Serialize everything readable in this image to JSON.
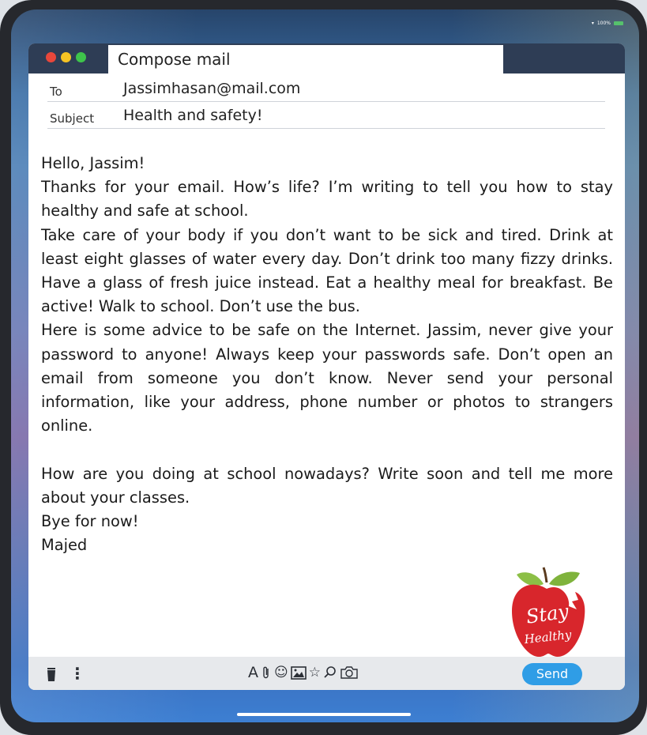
{
  "status_bar": {
    "battery": "100%"
  },
  "window": {
    "title": "Compose mail"
  },
  "to": {
    "label": "To",
    "value": "Jassimhasan@mail.com"
  },
  "subject": {
    "label": "Subject",
    "value": "Health and safety!"
  },
  "body": {
    "greeting": "Hello, Jassim!",
    "para1": "Thanks for your email. How’s life? I’m writing to tell you how to stay healthy and safe at school.",
    "para2": "Take care of your body if you don’t want to be sick and tired. Drink at least eight glasses of water every day. Don’t drink too many fizzy drinks. Have a glass of fresh juice instead. Eat a healthy meal for breakfast. Be active! Walk to school. Don’t use the bus.",
    "para3": "Here is some advice to be safe on the Internet. Jassim, never give your password to anyone! Always keep your passwords safe. Don’t open an email from someone you don’t know. Never send your personal information, like your address, phone number or photos to strangers online.",
    "para4": "How are you doing at school nowadays? Write soon and tell me more about your classes.",
    "signoff": "Bye for now!",
    "signature": "Majed"
  },
  "sticker": {
    "line1": "Stay",
    "line2": "Healthy"
  },
  "toolbar": {
    "font_glyph": "A",
    "attach_glyph": "🔗",
    "emoji_glyph": "☺",
    "star_glyph": "☆",
    "search_glyph": "⚲",
    "send_label": "Send"
  },
  "colors": {
    "titlebar": "#2e3d55",
    "send": "#2f9de6",
    "apple": "#d8262c"
  }
}
